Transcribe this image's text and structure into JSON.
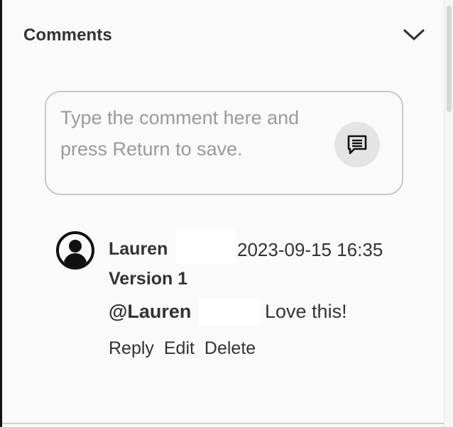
{
  "comments_panel": {
    "title": "Comments",
    "toggle_icon": "chevron-down-icon"
  },
  "new_comment": {
    "placeholder": "Type the comment here and press Return to save.",
    "value": "",
    "submit_icon": "comment-icon"
  },
  "comments": [
    {
      "avatar_icon": "user-avatar-icon",
      "author": "Lauren",
      "timestamp": "2023-09-15 16:35",
      "version": "Version 1",
      "mention": "@Lauren",
      "text": "Love this!",
      "actions": [
        "Reply",
        "Edit",
        "Delete"
      ]
    }
  ]
}
